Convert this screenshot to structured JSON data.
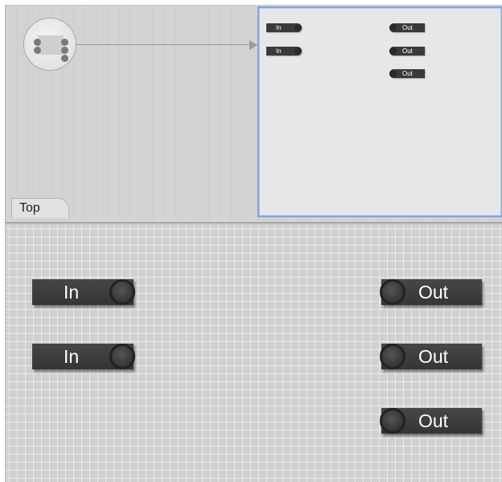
{
  "overview": {
    "tab_label": "Top",
    "mini_inputs": [
      {
        "label": "In"
      },
      {
        "label": "In"
      }
    ],
    "mini_outputs": [
      {
        "label": "Out"
      },
      {
        "label": "Out"
      },
      {
        "label": "Out"
      }
    ]
  },
  "canvas": {
    "inputs": [
      {
        "label": "In"
      },
      {
        "label": "In"
      }
    ],
    "outputs": [
      {
        "label": "Out"
      },
      {
        "label": "Out"
      },
      {
        "label": "Out"
      }
    ]
  },
  "colors": {
    "selection_border": "#7ea2ea",
    "port_fill": "#3b3b3b",
    "port_text": "#ffffff",
    "canvas_bg": "#d0d0d0",
    "overview_bg": "#d3d3d3"
  }
}
